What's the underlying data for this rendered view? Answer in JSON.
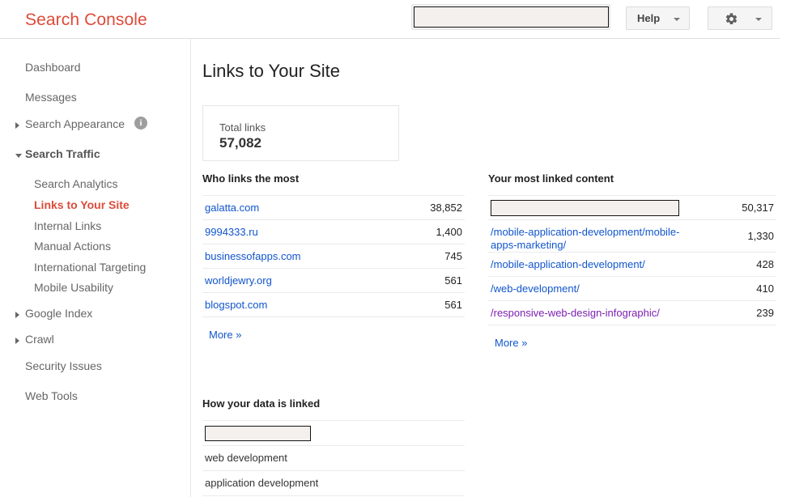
{
  "header": {
    "brand": "Search Console",
    "search": {
      "value": "",
      "redacted": true
    },
    "help_label": "Help",
    "gear_icon": "gear-icon",
    "help_caret_icon": "chevron-down-icon",
    "gear_caret_icon": "chevron-down-icon"
  },
  "sidebar": {
    "items": [
      {
        "label": "Dashboard",
        "level": 0,
        "state": "plain"
      },
      {
        "label": "Messages",
        "level": 0,
        "state": "plain"
      },
      {
        "label": "Search Appearance",
        "level": 0,
        "state": "collapsed",
        "info_icon": "info-icon",
        "info_glyph": "i"
      },
      {
        "label": "Search Traffic",
        "level": 0,
        "state": "expanded"
      },
      {
        "label": "Search Analytics",
        "level": 1,
        "state": "plain"
      },
      {
        "label": "Links to Your Site",
        "level": 1,
        "state": "selected"
      },
      {
        "label": "Internal Links",
        "level": 1,
        "state": "plain"
      },
      {
        "label": "Manual Actions",
        "level": 1,
        "state": "plain"
      },
      {
        "label": "International Targeting",
        "level": 1,
        "state": "plain"
      },
      {
        "label": "Mobile Usability",
        "level": 1,
        "state": "plain"
      },
      {
        "label": "Google Index",
        "level": 0,
        "state": "collapsed"
      },
      {
        "label": "Crawl",
        "level": 0,
        "state": "collapsed"
      },
      {
        "label": "Security Issues",
        "level": 0,
        "state": "plain"
      },
      {
        "label": "Web Tools",
        "level": 0,
        "state": "plain"
      }
    ]
  },
  "main": {
    "page_title": "Links to Your Site",
    "summary": {
      "label": "Total links",
      "value": "57,082"
    },
    "who_links_most": {
      "title": "Who links the most",
      "rows": [
        {
          "label": "galatta.com",
          "value": "38,852",
          "style": "link"
        },
        {
          "label": "9994333.ru",
          "value": "1,400",
          "style": "link"
        },
        {
          "label": "businessofapps.com",
          "value": "745",
          "style": "link"
        },
        {
          "label": "worldjewry.org",
          "value": "561",
          "style": "link"
        },
        {
          "label": "blogspot.com",
          "value": "561",
          "style": "link"
        }
      ],
      "more_label": "More »"
    },
    "most_linked_content": {
      "title": "Your most linked content",
      "rows": [
        {
          "label": "",
          "value": "50,317",
          "style": "redacted"
        },
        {
          "label": "/mobile-application-development/mobile-apps-marketing/",
          "value": "1,330",
          "style": "link"
        },
        {
          "label": "/mobile-application-development/",
          "value": "428",
          "style": "link"
        },
        {
          "label": "/web-development/",
          "value": "410",
          "style": "link"
        },
        {
          "label": "/responsive-web-design-infographic/",
          "value": "239",
          "style": "visited"
        }
      ],
      "more_label": "More »"
    },
    "how_data_linked": {
      "title": "How your data is linked",
      "rows": [
        {
          "label": "",
          "value": "",
          "style": "redacted"
        },
        {
          "label": "web development",
          "value": "",
          "style": "plain"
        },
        {
          "label": "application development",
          "value": "",
          "style": "plain"
        }
      ]
    }
  },
  "colors": {
    "brand": "#dd4b39",
    "link": "#1155cc",
    "visited": "#7c1fb0",
    "redaction_fill": "#f4f0ee",
    "redaction_border": "#141414"
  }
}
